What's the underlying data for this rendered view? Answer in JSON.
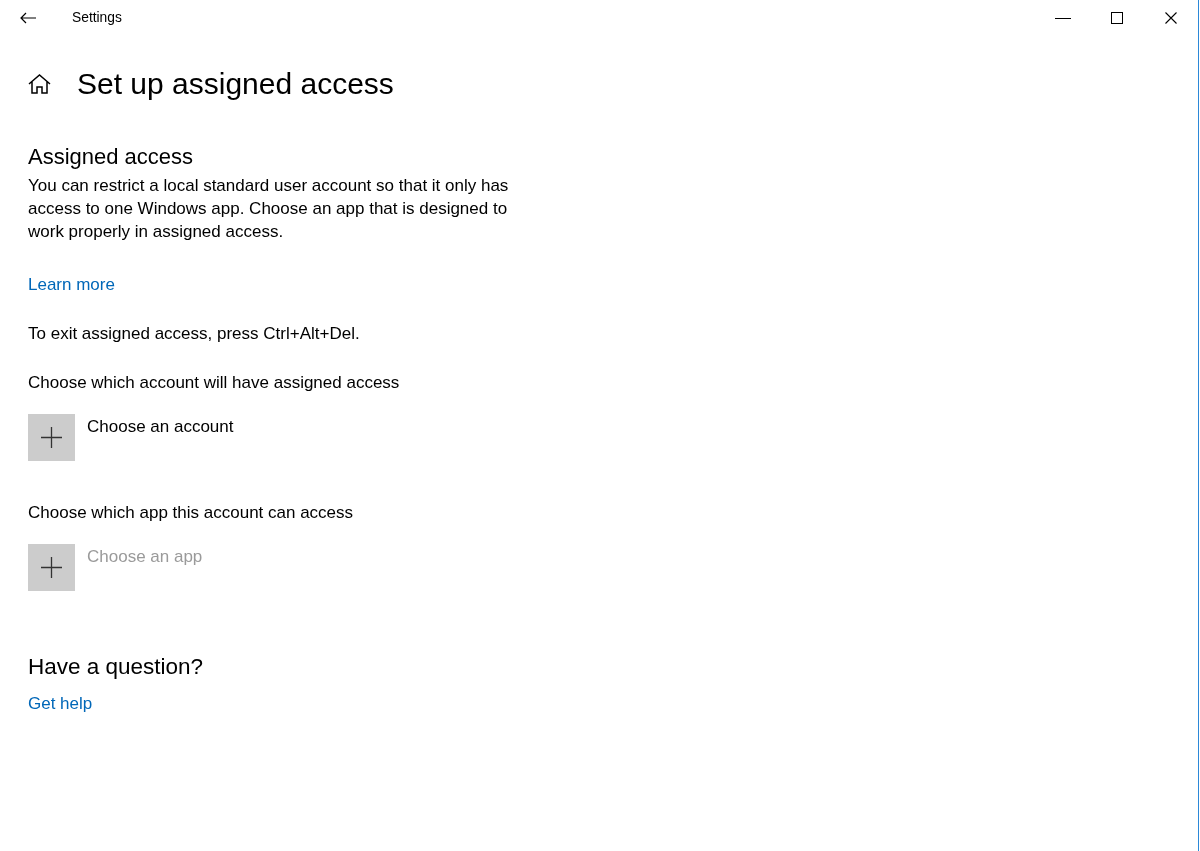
{
  "window": {
    "title": "Settings"
  },
  "page": {
    "title": "Set up assigned access"
  },
  "assigned_access": {
    "heading": "Assigned access",
    "description": "You can restrict a local standard user account so that it only has access to one Windows app. Choose an app that is designed to work properly in assigned access.",
    "learn_more": "Learn more",
    "exit_note": "To exit assigned access, press Ctrl+Alt+Del."
  },
  "pickers": [
    {
      "prompt": "Choose which account will have assigned access",
      "label": "Choose an account",
      "disabled": false
    },
    {
      "prompt": "Choose which app this account can access",
      "label": "Choose an app",
      "disabled": true
    }
  ],
  "help": {
    "heading": "Have a question?",
    "link": "Get help"
  }
}
